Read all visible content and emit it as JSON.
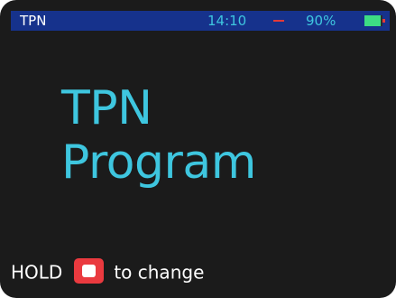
{
  "status_bar": {
    "app_label": "TPN",
    "time": "14:10",
    "battery_percent_text": "90%",
    "battery_level": 0.9
  },
  "main": {
    "title_line1": "TPN",
    "title_line2": "Program"
  },
  "hint": {
    "prefix": "HOLD",
    "button_icon": "red-square-button-icon",
    "suffix": "to change"
  },
  "colors": {
    "background": "#1b1b1b",
    "status_bar": "#16328c",
    "accent_cyan": "#3ec6df",
    "button_red": "#ea3a3f",
    "battery_green": "#3ddc84"
  }
}
